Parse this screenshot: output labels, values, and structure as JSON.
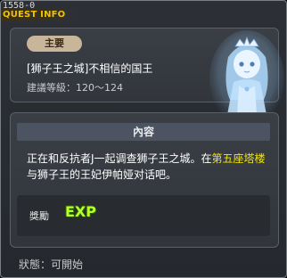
{
  "window": {
    "id_label": "1558-0",
    "title": "QUEST INFO"
  },
  "quest": {
    "type_badge": "主要",
    "name": "[狮子王之城]不相信的国王",
    "level": "建議等級：120～124"
  },
  "content": {
    "header": "內容",
    "desc_part1": "正在和反抗者J一起调查狮子王之城。在",
    "desc_highlight": "第五座塔楼",
    "desc_part2": "与狮子王的王妃伊帕娅对话吧。"
  },
  "reward": {
    "label": "獎勵",
    "exp_text": "EXP"
  },
  "status": {
    "text": "狀態：可開始"
  },
  "colors": {
    "title": "#f2c200",
    "highlight": "#f5e600",
    "exp": "#b7ff2c",
    "badge": "#c9b59a"
  }
}
